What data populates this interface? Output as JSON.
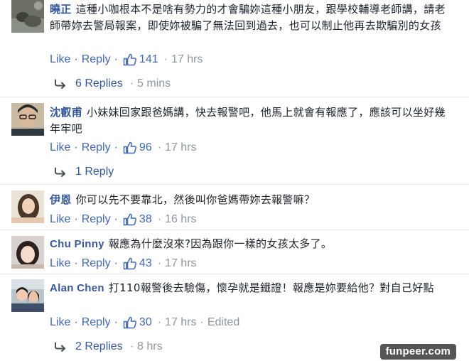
{
  "comments": [
    {
      "name": "曉正",
      "text": "這種小咖根本不是啥有勢力的才會騙妳這種小朋友，跟學校輔導老師講，請老師帶妳去警局報案，即使妳被騙了無法回到過去，也可以制止他再去欺騙別的女孩",
      "like_label": "Like",
      "reply_label": "Reply",
      "separator": "·",
      "likes": "141",
      "time": "17 hrs",
      "replies": {
        "label": "6 Replies",
        "time": "5 mins"
      }
    },
    {
      "name": "沈叡甫",
      "text": "小妹妹回家跟爸媽講，快去報警吧，他馬上就會有報應了，應該可以坐好幾年牢吧",
      "like_label": "Like",
      "reply_label": "Reply",
      "separator": "·",
      "likes": "96",
      "time": "17 hrs",
      "replies": {
        "label": "1 Reply",
        "time": ""
      }
    },
    {
      "name": "伊恩",
      "text": "你可以先不要靠北，然後叫你爸媽帶妳去報警嘛？",
      "like_label": "Like",
      "reply_label": "Reply",
      "separator": "·",
      "likes": "38",
      "time": "16 hrs"
    },
    {
      "name": "Chu Pinny",
      "text": "報應為什麼沒來?因為跟你一樣的女孩太多了。",
      "like_label": "Like",
      "reply_label": "Reply",
      "separator": "·",
      "likes": "43",
      "time": "17 hrs"
    },
    {
      "name": "Alan Chen",
      "text": "打110報警後去驗傷，懷孕就是鐵證！報應是妳要給他？對自己好點",
      "like_label": "Like",
      "reply_label": "Reply",
      "separator": "·",
      "likes": "30",
      "time": "17 hrs",
      "edited": "Edited",
      "replies": {
        "label": "2 Replies",
        "time": "8 hrs"
      }
    }
  ],
  "watermark": "funpeer.com",
  "colors": {
    "link": "#4267b2",
    "name": "#365899",
    "meta": "#90949c",
    "text": "#1d2129"
  },
  "icons": {
    "like": "thumbs-up-icon",
    "reply": "reply-arrow-icon"
  }
}
